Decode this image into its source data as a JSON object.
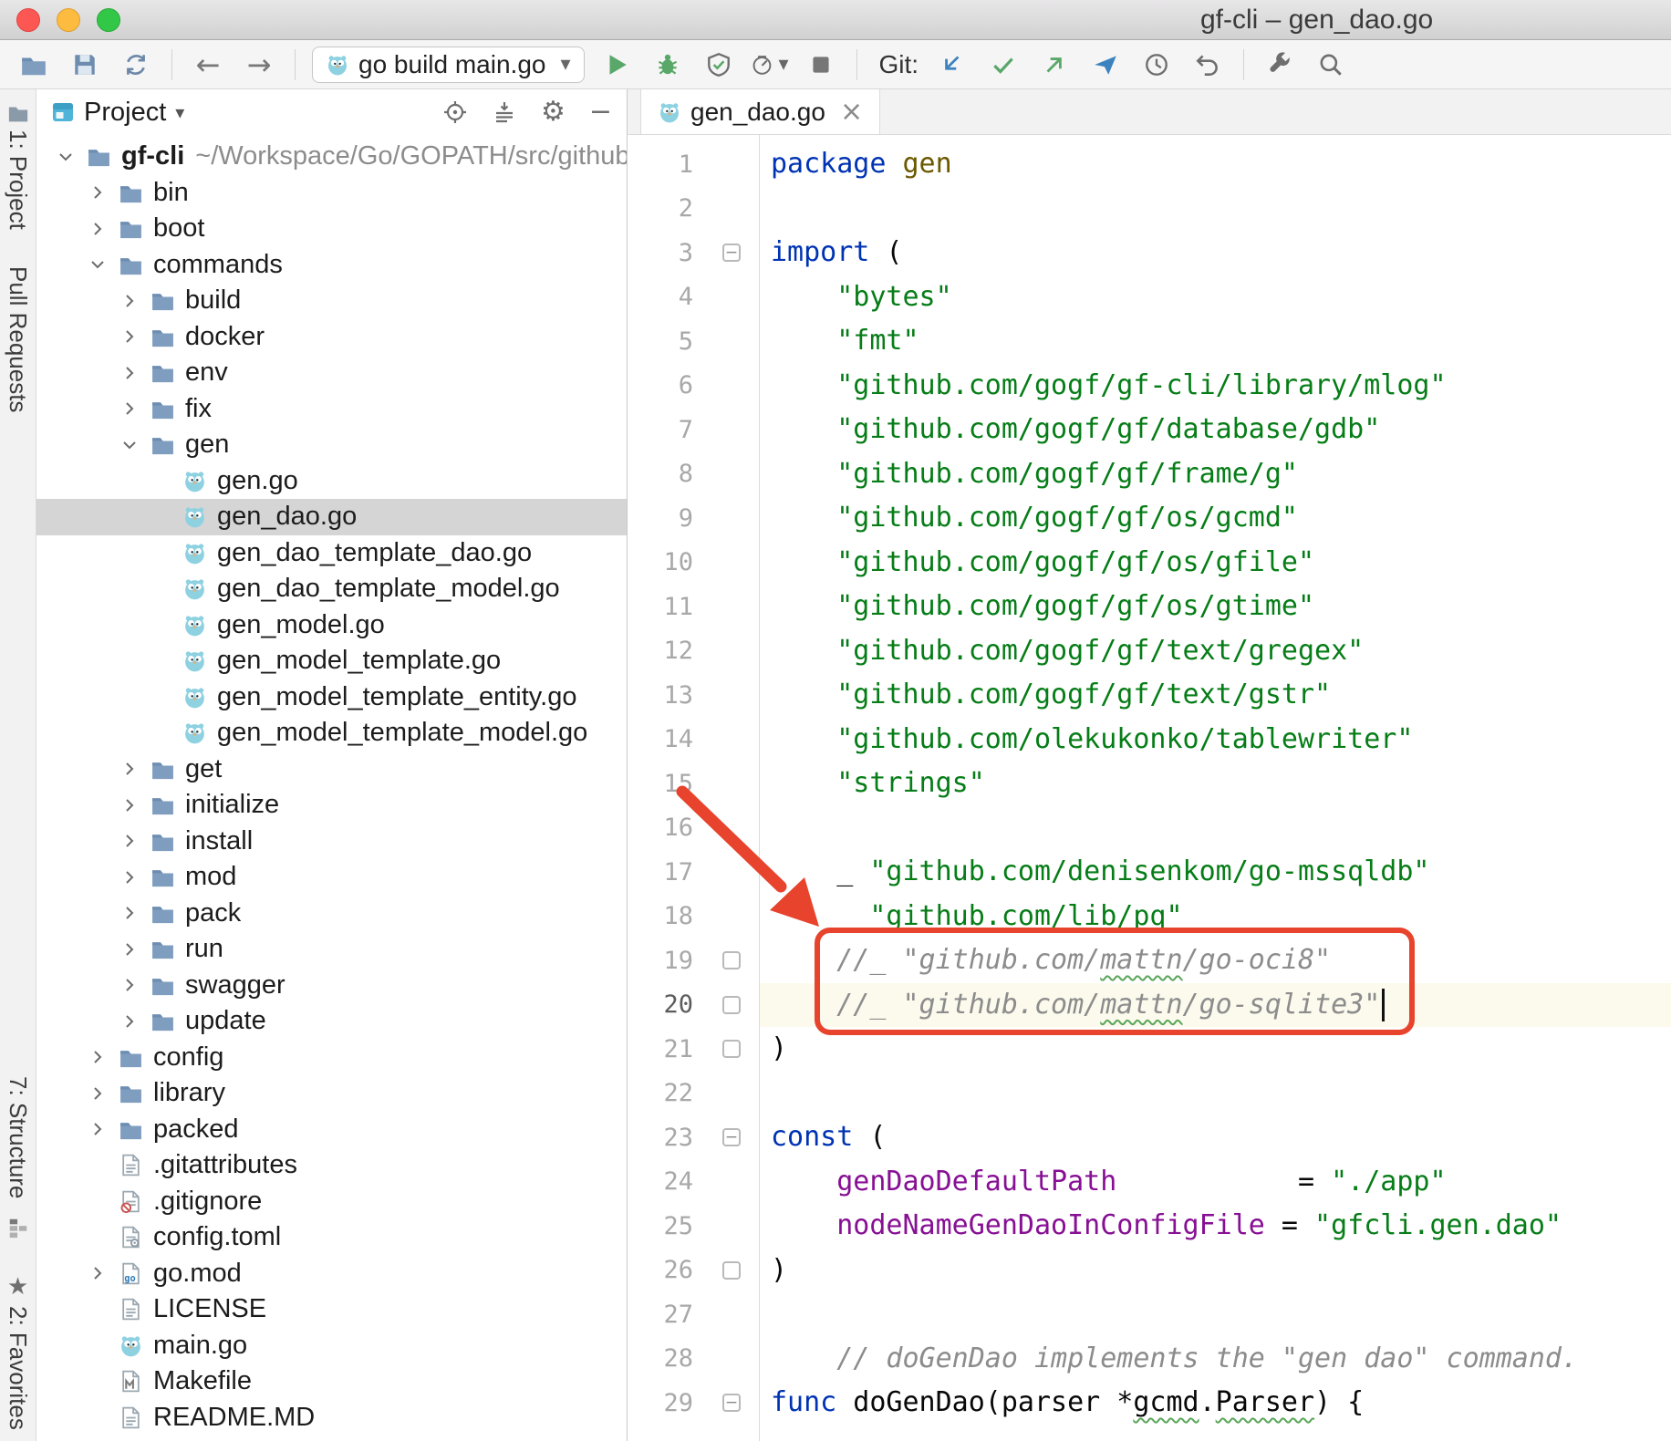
{
  "window": {
    "title": "gf-cli – gen_dao.go"
  },
  "toolbar": {
    "run_config": "go build main.go",
    "git_label": "Git:"
  },
  "stripes": {
    "project": "1: Project",
    "pull_requests": "Pull Requests",
    "structure": "7: Structure",
    "favorites": "2: Favorites"
  },
  "project": {
    "title": "Project",
    "items": [
      {
        "indent": 0,
        "arrow": "open",
        "icon": "folder",
        "label": "gf-cli",
        "suffix": "~/Workspace/Go/GOPATH/src/github",
        "bold": true
      },
      {
        "indent": 1,
        "arrow": "closed",
        "icon": "folder",
        "label": "bin"
      },
      {
        "indent": 1,
        "arrow": "closed",
        "icon": "folder",
        "label": "boot"
      },
      {
        "indent": 1,
        "arrow": "open",
        "icon": "folder",
        "label": "commands"
      },
      {
        "indent": 2,
        "arrow": "closed",
        "icon": "folder",
        "label": "build"
      },
      {
        "indent": 2,
        "arrow": "closed",
        "icon": "folder",
        "label": "docker"
      },
      {
        "indent": 2,
        "arrow": "closed",
        "icon": "folder",
        "label": "env"
      },
      {
        "indent": 2,
        "arrow": "closed",
        "icon": "folder",
        "label": "fix"
      },
      {
        "indent": 2,
        "arrow": "open",
        "icon": "folder",
        "label": "gen"
      },
      {
        "indent": 3,
        "icon": "go",
        "label": "gen.go"
      },
      {
        "indent": 3,
        "icon": "go",
        "label": "gen_dao.go",
        "selected": true
      },
      {
        "indent": 3,
        "icon": "go",
        "label": "gen_dao_template_dao.go"
      },
      {
        "indent": 3,
        "icon": "go",
        "label": "gen_dao_template_model.go"
      },
      {
        "indent": 3,
        "icon": "go",
        "label": "gen_model.go"
      },
      {
        "indent": 3,
        "icon": "go",
        "label": "gen_model_template.go"
      },
      {
        "indent": 3,
        "icon": "go",
        "label": "gen_model_template_entity.go"
      },
      {
        "indent": 3,
        "icon": "go",
        "label": "gen_model_template_model.go"
      },
      {
        "indent": 2,
        "arrow": "closed",
        "icon": "folder",
        "label": "get"
      },
      {
        "indent": 2,
        "arrow": "closed",
        "icon": "folder",
        "label": "initialize"
      },
      {
        "indent": 2,
        "arrow": "closed",
        "icon": "folder",
        "label": "install"
      },
      {
        "indent": 2,
        "arrow": "closed",
        "icon": "folder",
        "label": "mod"
      },
      {
        "indent": 2,
        "arrow": "closed",
        "icon": "folder",
        "label": "pack"
      },
      {
        "indent": 2,
        "arrow": "closed",
        "icon": "folder",
        "label": "run"
      },
      {
        "indent": 2,
        "arrow": "closed",
        "icon": "folder",
        "label": "swagger"
      },
      {
        "indent": 2,
        "arrow": "closed",
        "icon": "folder",
        "label": "update"
      },
      {
        "indent": 1,
        "arrow": "closed",
        "icon": "folder",
        "label": "config"
      },
      {
        "indent": 1,
        "arrow": "closed",
        "icon": "folder",
        "label": "library"
      },
      {
        "indent": 1,
        "arrow": "closed",
        "icon": "folder",
        "label": "packed"
      },
      {
        "indent": 1,
        "icon": "file-text",
        "label": ".gitattributes"
      },
      {
        "indent": 1,
        "icon": "file-ignore",
        "label": ".gitignore"
      },
      {
        "indent": 1,
        "icon": "file-toml",
        "label": "config.toml"
      },
      {
        "indent": 1,
        "arrow": "closed",
        "icon": "file-gomod",
        "label": "go.mod"
      },
      {
        "indent": 1,
        "icon": "file-text",
        "label": "LICENSE"
      },
      {
        "indent": 1,
        "icon": "go",
        "label": "main.go"
      },
      {
        "indent": 1,
        "icon": "file-make",
        "label": "Makefile"
      },
      {
        "indent": 1,
        "icon": "file-text",
        "label": "README.MD"
      }
    ]
  },
  "editor": {
    "tab": "gen_dao.go",
    "lines": [
      {
        "n": 1,
        "tk": [
          [
            "kw",
            "package"
          ],
          [
            "pl",
            " "
          ],
          [
            "pkg",
            "gen"
          ]
        ]
      },
      {
        "n": 2,
        "tk": []
      },
      {
        "n": 3,
        "fold": "minus",
        "tk": [
          [
            "kw",
            "import"
          ],
          [
            "pl",
            " ("
          ]
        ]
      },
      {
        "n": 4,
        "tk": [
          [
            "pl",
            "    "
          ],
          [
            "str",
            "\"bytes\""
          ]
        ]
      },
      {
        "n": 5,
        "tk": [
          [
            "pl",
            "    "
          ],
          [
            "str",
            "\"fmt\""
          ]
        ]
      },
      {
        "n": 6,
        "tk": [
          [
            "pl",
            "    "
          ],
          [
            "str",
            "\"github.com/gogf/gf-cli/library/mlog\""
          ]
        ]
      },
      {
        "n": 7,
        "tk": [
          [
            "pl",
            "    "
          ],
          [
            "str",
            "\"github.com/gogf/gf/database/gdb\""
          ]
        ]
      },
      {
        "n": 8,
        "tk": [
          [
            "pl",
            "    "
          ],
          [
            "str",
            "\"github.com/gogf/gf/frame/g\""
          ]
        ]
      },
      {
        "n": 9,
        "tk": [
          [
            "pl",
            "    "
          ],
          [
            "str",
            "\"github.com/gogf/gf/os/gcmd\""
          ]
        ]
      },
      {
        "n": 10,
        "tk": [
          [
            "pl",
            "    "
          ],
          [
            "str",
            "\"github.com/gogf/gf/os/gfile\""
          ]
        ]
      },
      {
        "n": 11,
        "tk": [
          [
            "pl",
            "    "
          ],
          [
            "str",
            "\"github.com/gogf/gf/os/gtime\""
          ]
        ]
      },
      {
        "n": 12,
        "tk": [
          [
            "pl",
            "    "
          ],
          [
            "str",
            "\"github.com/gogf/gf/text/gregex\""
          ]
        ]
      },
      {
        "n": 13,
        "tk": [
          [
            "pl",
            "    "
          ],
          [
            "str",
            "\"github.com/gogf/gf/text/gstr\""
          ]
        ]
      },
      {
        "n": 14,
        "tk": [
          [
            "pl",
            "    "
          ],
          [
            "str",
            "\"github.com/olekukonko/tablewriter\""
          ]
        ]
      },
      {
        "n": 15,
        "tk": [
          [
            "pl",
            "    "
          ],
          [
            "str",
            "\"strings\""
          ]
        ]
      },
      {
        "n": 16,
        "tk": []
      },
      {
        "n": 17,
        "tk": [
          [
            "pl",
            "    _ "
          ],
          [
            "str",
            "\"github.com/denisenkom/go-mssqldb\""
          ]
        ]
      },
      {
        "n": 18,
        "tk": [
          [
            "pl",
            "    _ "
          ],
          [
            "str",
            "\"github.com/lib/pq\""
          ]
        ]
      },
      {
        "n": 19,
        "fold": "box",
        "tk": [
          [
            "cmt",
            "    //_ \"github.com/"
          ],
          [
            "cmtw",
            "mattn"
          ],
          [
            "cmt",
            "/go-oci8\""
          ]
        ]
      },
      {
        "n": 20,
        "fold": "box",
        "current": true,
        "caret": true,
        "tk": [
          [
            "cmt",
            "    //_ \"github.com/"
          ],
          [
            "cmtw",
            "mattn"
          ],
          [
            "cmt",
            "/go-sqlite3\""
          ]
        ]
      },
      {
        "n": 21,
        "fold": "end",
        "tk": [
          [
            "pl",
            ")"
          ]
        ]
      },
      {
        "n": 22,
        "tk": []
      },
      {
        "n": 23,
        "fold": "minus",
        "tk": [
          [
            "kw",
            "const"
          ],
          [
            "pl",
            " ("
          ]
        ]
      },
      {
        "n": 24,
        "tk": [
          [
            "pl",
            "    "
          ],
          [
            "field",
            "genDaoDefaultPath"
          ],
          [
            "pl",
            "           = "
          ],
          [
            "str",
            "\"./app\""
          ]
        ]
      },
      {
        "n": 25,
        "tk": [
          [
            "pl",
            "    "
          ],
          [
            "field",
            "nodeNameGenDaoInConfigFile"
          ],
          [
            "pl",
            " = "
          ],
          [
            "str",
            "\"gfcli.gen.dao\""
          ]
        ]
      },
      {
        "n": 26,
        "fold": "end",
        "tk": [
          [
            "pl",
            ")"
          ]
        ]
      },
      {
        "n": 27,
        "tk": []
      },
      {
        "n": 28,
        "tk": [
          [
            "cmt",
            "    // doGenDao implements the \"gen dao\" command."
          ]
        ]
      },
      {
        "n": 29,
        "fold": "minus",
        "tk": [
          [
            "kw",
            "func"
          ],
          [
            "pl",
            " doGenDao(parser *"
          ],
          [
            "wavy",
            "gcmd"
          ],
          [
            "pl",
            "."
          ],
          [
            "wavy",
            "Parser"
          ],
          [
            "pl",
            ") {"
          ]
        ]
      }
    ]
  },
  "annotation": {
    "color": "#e8432c"
  }
}
